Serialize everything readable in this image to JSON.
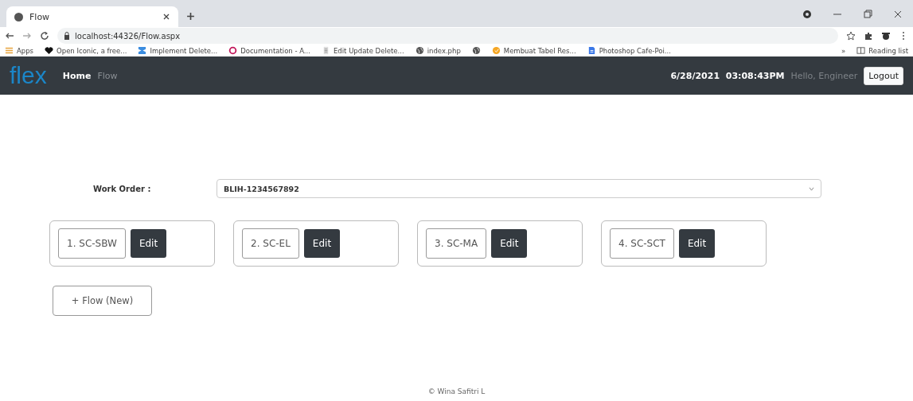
{
  "browser": {
    "tab": {
      "title": "Flow"
    },
    "url": "localhost:44326/Flow.aspx",
    "bookmarks": [
      {
        "kind": "apps",
        "label": "Apps"
      },
      {
        "kind": "heart",
        "label": "Open Iconic, a free..."
      },
      {
        "kind": "blue",
        "label": "Implement Delete..."
      },
      {
        "kind": "ring",
        "label": "Documentation - A..."
      },
      {
        "kind": "doc",
        "label": "Edit Update Delete..."
      },
      {
        "kind": "globe",
        "label": "index.php"
      },
      {
        "kind": "globe"
      },
      {
        "kind": "orange",
        "label": "Membuat Tabel Res..."
      },
      {
        "kind": "file",
        "label": "Photoshop Cafe-Poi..."
      }
    ],
    "more": "»",
    "reading_list": "Reading list"
  },
  "navbar": {
    "brand": "flex",
    "links": [
      {
        "label": "Home",
        "selected": true
      },
      {
        "label": "Flow",
        "selected": false
      }
    ],
    "datetime": "6/28/2021  03:08:43PM",
    "greeting": "Hello, Engineer",
    "logout": "Logout"
  },
  "work_order": {
    "label": "Work Order :",
    "value": "BLIH-1234567892"
  },
  "flows": [
    {
      "name": "1. SC-SBW",
      "action": "Edit"
    },
    {
      "name": "2. SC-EL",
      "action": "Edit"
    },
    {
      "name": "3. SC-MA",
      "action": "Edit"
    },
    {
      "name": "4. SC-SCT",
      "action": "Edit"
    }
  ],
  "new_flow": "+ Flow (New)",
  "footer": "© Wina Safitri L"
}
